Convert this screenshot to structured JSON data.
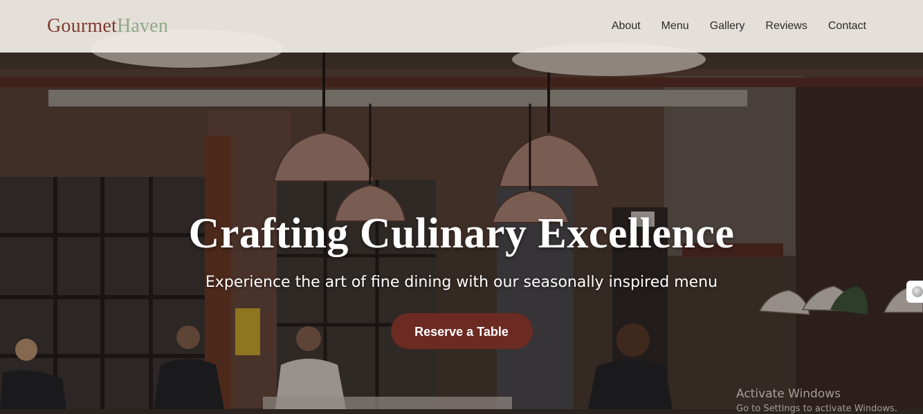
{
  "brand": {
    "part1": "Gourmet",
    "part2": "Haven"
  },
  "nav": {
    "items": [
      "About",
      "Menu",
      "Gallery",
      "Reviews",
      "Contact"
    ]
  },
  "hero": {
    "title": "Crafting Culinary Excellence",
    "subtitle": "Experience the art of fine dining with our seasonally inspired menu",
    "cta": "Reserve a Table"
  },
  "watermark": {
    "line1": "Activate Windows",
    "line2": "Go to Settings to activate Windows."
  },
  "colors": {
    "brand_primary": "#7d3a30",
    "brand_secondary": "#8fa886",
    "cta_bg": "#6b2a22",
    "navbar_bg": "#f2ede7"
  }
}
